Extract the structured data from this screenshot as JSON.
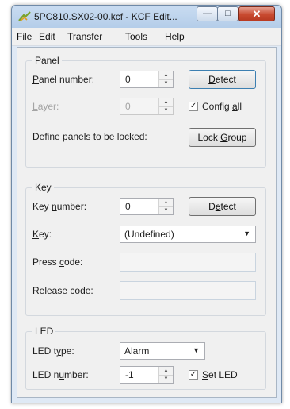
{
  "window": {
    "title": "5PC810.SX02-00.kcf - KCF Edit...",
    "controls": {
      "minimize": "—",
      "maximize": "□",
      "close": "✕"
    }
  },
  "menu": [
    {
      "pre": "",
      "key": "F",
      "post": "ile"
    },
    {
      "pre": "",
      "key": "E",
      "post": "dit"
    },
    {
      "pre": "T",
      "key": "r",
      "post": "ansfer"
    },
    {
      "pre": "",
      "key": "T",
      "post": "ools"
    },
    {
      "pre": "",
      "key": "H",
      "post": "elp"
    }
  ],
  "panel": {
    "title": "Panel",
    "panel_number": {
      "pre": "",
      "key": "P",
      "post": "anel number:",
      "value": "0"
    },
    "detect": {
      "pre": "",
      "key": "D",
      "post": "etect"
    },
    "layer": {
      "pre": "",
      "key": "L",
      "post": "ayer:",
      "value": "0"
    },
    "config_all": {
      "pre": "Config ",
      "key": "a",
      "post": "ll",
      "checked": true
    },
    "lock_label": "Define panels to be locked:",
    "lock_group": {
      "pre": "Lock ",
      "key": "G",
      "post": "roup"
    }
  },
  "key": {
    "title": "Key",
    "key_number": {
      "pre": "Key ",
      "key": "n",
      "post": "umber:",
      "value": "0"
    },
    "detect": {
      "pre": "D",
      "key": "e",
      "post": "tect"
    },
    "key_select": {
      "pre": "",
      "key": "K",
      "post": "ey:",
      "value": "(Undefined)"
    },
    "press_code": {
      "pre": "Press ",
      "key": "c",
      "post": "ode:"
    },
    "release_code": {
      "pre": "Release c",
      "key": "o",
      "post": "de:"
    }
  },
  "led": {
    "title": "LED",
    "led_type": {
      "pre": "LED t",
      "key": "y",
      "post": "pe:",
      "value": "Alarm"
    },
    "led_number": {
      "pre": "LED n",
      "key": "u",
      "post": "mber:",
      "value": "-1"
    },
    "set_led": {
      "pre": "",
      "key": "S",
      "post": "et LED",
      "checked": true
    }
  },
  "icons": {
    "checkmark": "✓",
    "spin_up": "▲",
    "spin_down": "▼",
    "dropdown": "▼"
  }
}
